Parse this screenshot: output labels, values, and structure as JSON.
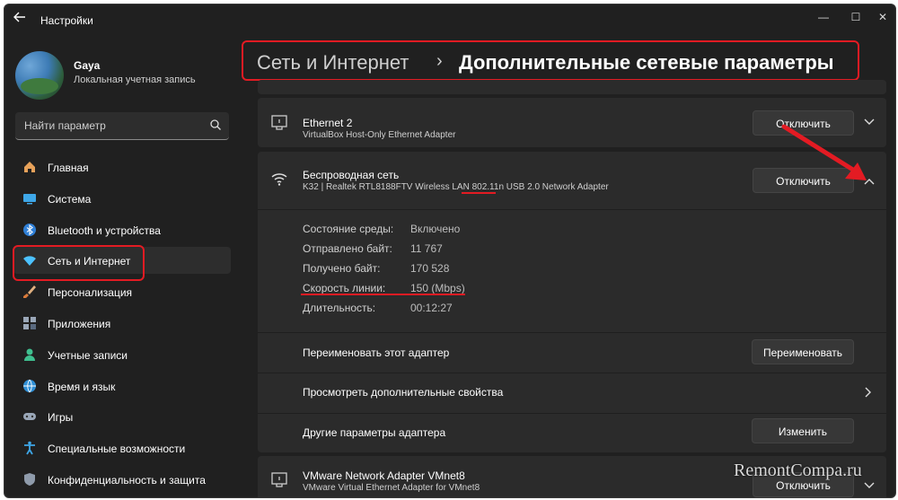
{
  "window": {
    "title": "Настройки",
    "controls": [
      "—",
      "☐",
      "✕"
    ]
  },
  "user": {
    "name": "Gaya",
    "account_type": "Локальная учетная запись"
  },
  "search": {
    "placeholder": "Найти параметр"
  },
  "sidebar": {
    "items": [
      {
        "label": "Главная",
        "icon": "home-icon"
      },
      {
        "label": "Система",
        "icon": "system-icon"
      },
      {
        "label": "Bluetooth и устройства",
        "icon": "bluetooth-icon"
      },
      {
        "label": "Сеть и Интернет",
        "icon": "wifi-icon",
        "active": true
      },
      {
        "label": "Персонализация",
        "icon": "brush-icon"
      },
      {
        "label": "Приложения",
        "icon": "apps-icon"
      },
      {
        "label": "Учетные записи",
        "icon": "account-icon"
      },
      {
        "label": "Время и язык",
        "icon": "globe-icon"
      },
      {
        "label": "Игры",
        "icon": "gamepad-icon"
      },
      {
        "label": "Специальные возможности",
        "icon": "accessibility-icon"
      },
      {
        "label": "Конфиденциальность и защита",
        "icon": "shield-icon"
      }
    ]
  },
  "breadcrumb": {
    "parent": "Сеть и Интернет",
    "separator": "›",
    "current": "Дополнительные сетевые параметры"
  },
  "adapters": {
    "ethernet2": {
      "title": "Ethernet 2",
      "subtitle": "VirtualBox Host-Only Ethernet Adapter",
      "button": "Отключить"
    },
    "wireless": {
      "title": "Беспроводная сеть",
      "subtitle": "K32 | Realtek RTL8188FTV Wireless LAN 802.11n USB 2.0 Network Adapter",
      "button": "Отключить",
      "details": [
        {
          "label": "Состояние среды:",
          "value": "Включено"
        },
        {
          "label": "Отправлено байт:",
          "value": "11 767"
        },
        {
          "label": "Получено байт:",
          "value": "170 528"
        },
        {
          "label": "Скорость линии:",
          "value": "150 (Mbps)"
        },
        {
          "label": "Длительность:",
          "value": "00:12:27"
        }
      ],
      "rename_label": "Переименовать этот адаптер",
      "rename_button": "Переименовать",
      "properties_label": "Просмотреть дополнительные свойства",
      "other_label": "Другие параметры адаптера",
      "other_button": "Изменить"
    },
    "vmnet8": {
      "title": "VMware Network Adapter VMnet8",
      "subtitle": "VMware Virtual Ethernet Adapter for VMnet8",
      "button": "Отключить"
    }
  },
  "watermark": "RemontCompa.ru",
  "colors": {
    "highlight": "#e31b23",
    "accent": "#4cc2ff",
    "background": "#202020",
    "card": "#2b2b2b"
  }
}
